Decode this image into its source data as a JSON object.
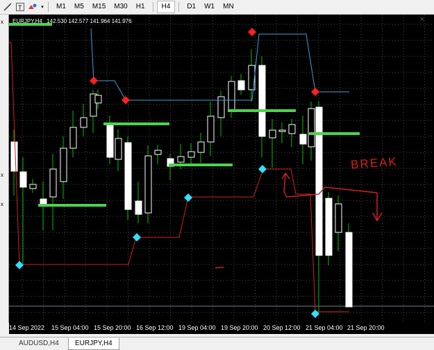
{
  "toolbar": {
    "timeframes": [
      "M1",
      "M5",
      "M15",
      "M30",
      "H1",
      "H4",
      "D1",
      "W1",
      "MN"
    ],
    "active_timeframe": "H4",
    "icons": [
      "line-icon",
      "text-icon",
      "shapes-icon"
    ]
  },
  "chart": {
    "symbol_label": "EURJPY,H4",
    "ohlc": "142.530 142.577 141.964 141.976",
    "annotation": "BREAK",
    "colors": {
      "bull": "#ffffff",
      "bear": "#ffffff",
      "wick": "#00c000",
      "background": "#000000",
      "grid": "#4a4a4a",
      "sr_level": "#4cd44c",
      "red_line": "#d42020",
      "blue_line": "#3fa0e0",
      "top_marker": "#ff2020",
      "bottom_marker": "#30e0ff"
    }
  },
  "time_axis": {
    "labels": [
      "14 Sep 2022",
      "15 Sep 04:00",
      "15 Sep 20:00",
      "16 Sep 12:00",
      "19 Sep 04:00",
      "19 Sep 20:00",
      "20 Sep 12:00",
      "21 Sep 04:00",
      "21 Sep 20:00"
    ]
  },
  "tabs": {
    "items": [
      "AUDUSD,H4",
      "EURJPY,H4"
    ],
    "active": "EURJPY,H4"
  }
}
